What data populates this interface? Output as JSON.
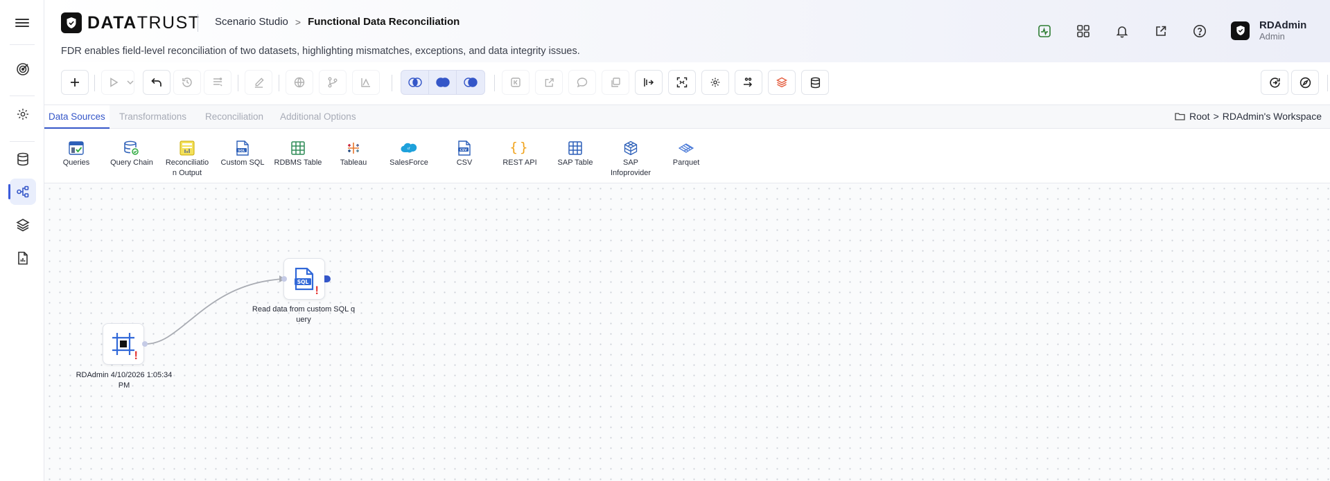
{
  "app": {
    "logo_bold": "DATA",
    "logo_light": "TRUST",
    "breadcrumb_parent": "Scenario Studio",
    "breadcrumb_current": "Functional Data Reconciliation",
    "subtitle": "FDR enables field-level reconciliation of two datasets, highlighting mismatches, exceptions, and data integrity issues."
  },
  "user": {
    "name": "RDAdmin",
    "role": "Admin"
  },
  "tabs": [
    {
      "label": "Data Sources",
      "active": true
    },
    {
      "label": "Transformations",
      "active": false
    },
    {
      "label": "Reconciliation",
      "active": false
    },
    {
      "label": "Additional Options",
      "active": false
    }
  ],
  "workspace": {
    "root": "Root",
    "separator": ">",
    "name": "RDAdmin's Workspace"
  },
  "palette": [
    {
      "label": "Queries",
      "icon": "queries-icon"
    },
    {
      "label": "Query Chain",
      "icon": "query-chain-icon"
    },
    {
      "label": "Reconciliation Output",
      "icon": "reconciliation-output-icon"
    },
    {
      "label": "Custom SQL",
      "icon": "custom-sql-icon"
    },
    {
      "label": "RDBMS Table",
      "icon": "rdbms-table-icon"
    },
    {
      "label": "Tableau",
      "icon": "tableau-icon"
    },
    {
      "label": "SalesForce",
      "icon": "salesforce-icon"
    },
    {
      "label": "CSV",
      "icon": "csv-icon"
    },
    {
      "label": "REST API",
      "icon": "rest-api-icon"
    },
    {
      "label": "SAP Table",
      "icon": "sap-table-icon"
    },
    {
      "label": "SAP Infoprovider",
      "icon": "sap-infoprovider-icon"
    },
    {
      "label": "Parquet",
      "icon": "parquet-icon"
    }
  ],
  "nodes": {
    "source": {
      "label": "RDAdmin 4/10/2026 1:05:34 PM",
      "warning": "!"
    },
    "custom_sql": {
      "label": "Read data from custom SQL query",
      "icon_text": "SQL",
      "warning": "!"
    }
  },
  "colors": {
    "accent": "#3456c8",
    "warning": "#e53935",
    "health": "#2e7d32"
  }
}
